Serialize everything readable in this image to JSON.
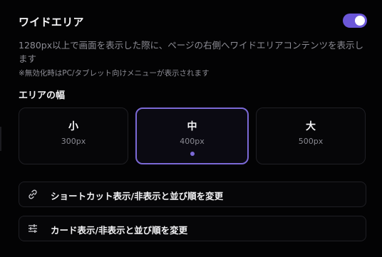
{
  "wide_area": {
    "title": "ワイドエリア",
    "enabled": true,
    "description": "1280px以上で画面を表示した際に、ページの右側へワイドエリアコンテンツを表示します",
    "note": "※無効化時はPC/タブレット向けメニューが表示されます"
  },
  "area_width": {
    "label": "エリアの幅",
    "options": [
      {
        "name": "小",
        "px": "300px",
        "selected": false
      },
      {
        "name": "中",
        "px": "400px",
        "selected": true
      },
      {
        "name": "大",
        "px": "500px",
        "selected": false
      }
    ]
  },
  "actions": [
    {
      "icon": "link-icon",
      "label": "ショートカット表示/非表示と並び順を変更"
    },
    {
      "icon": "sliders-icon",
      "label": "カード表示/非表示と並び順を変更"
    }
  ],
  "colors": {
    "accent": "#6b57d8",
    "selected_border": "#7b69d6",
    "background": "#030304"
  }
}
